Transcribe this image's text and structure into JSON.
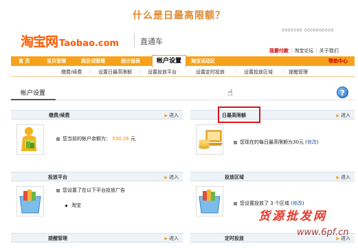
{
  "page_heading": "什么是日最高限额？",
  "logo": {
    "cn": "淘宝网",
    "en": "Taobao.com"
  },
  "product_name": "直通车",
  "top_right_text": "0000000 0000000000",
  "top_links": {
    "item1": "我要付款",
    "item2": "淘宝论坛",
    "item3": "关于我们"
  },
  "nav": {
    "items": [
      "首 页",
      "宝贝管理",
      "类目词管理",
      "统计报表",
      "帐户设置",
      "淘宝活动区"
    ],
    "help": "帮助中心"
  },
  "subnav": [
    "缴费/续费",
    "设置日最高限额",
    "设置投放平台",
    "设置定时投放",
    "设置投放区域",
    "提醒管理"
  ],
  "section_title": "帐户设置",
  "help_icon": "?",
  "panels": {
    "recharge": {
      "title": "缴费/续费",
      "enter": "进入",
      "text_prefix": "您当前的帐户余额为：",
      "amount": "530.26",
      "text_suffix": "元"
    },
    "daily_limit": {
      "title": "日最高限额",
      "enter": "进入",
      "text_prefix": "您现在的每日最高限额为30元",
      "action": "修改"
    },
    "platform": {
      "title": "投放平台",
      "enter": "进入",
      "text": "您设置了在以下平台投放广告",
      "bullet": "淘宝"
    },
    "region": {
      "title": "投放区域",
      "enter": "进入",
      "text_prefix": "您设置投放了",
      "count": "3",
      "text_suffix": "个区域",
      "action": "修改"
    },
    "reminder": {
      "title": "提醒管理",
      "enter": "进入"
    },
    "schedule": {
      "title": "定时投放",
      "enter": "进入"
    }
  },
  "watermark": {
    "main": "货源批发网",
    "sub": "www.6pf.cn"
  },
  "colors": {
    "nav_orange": "#f7a21a",
    "highlight_red": "#d9111a",
    "brand_orange": "#ff5a00",
    "accent_orange": "#f08c00",
    "link_blue": "#2a5caa"
  }
}
